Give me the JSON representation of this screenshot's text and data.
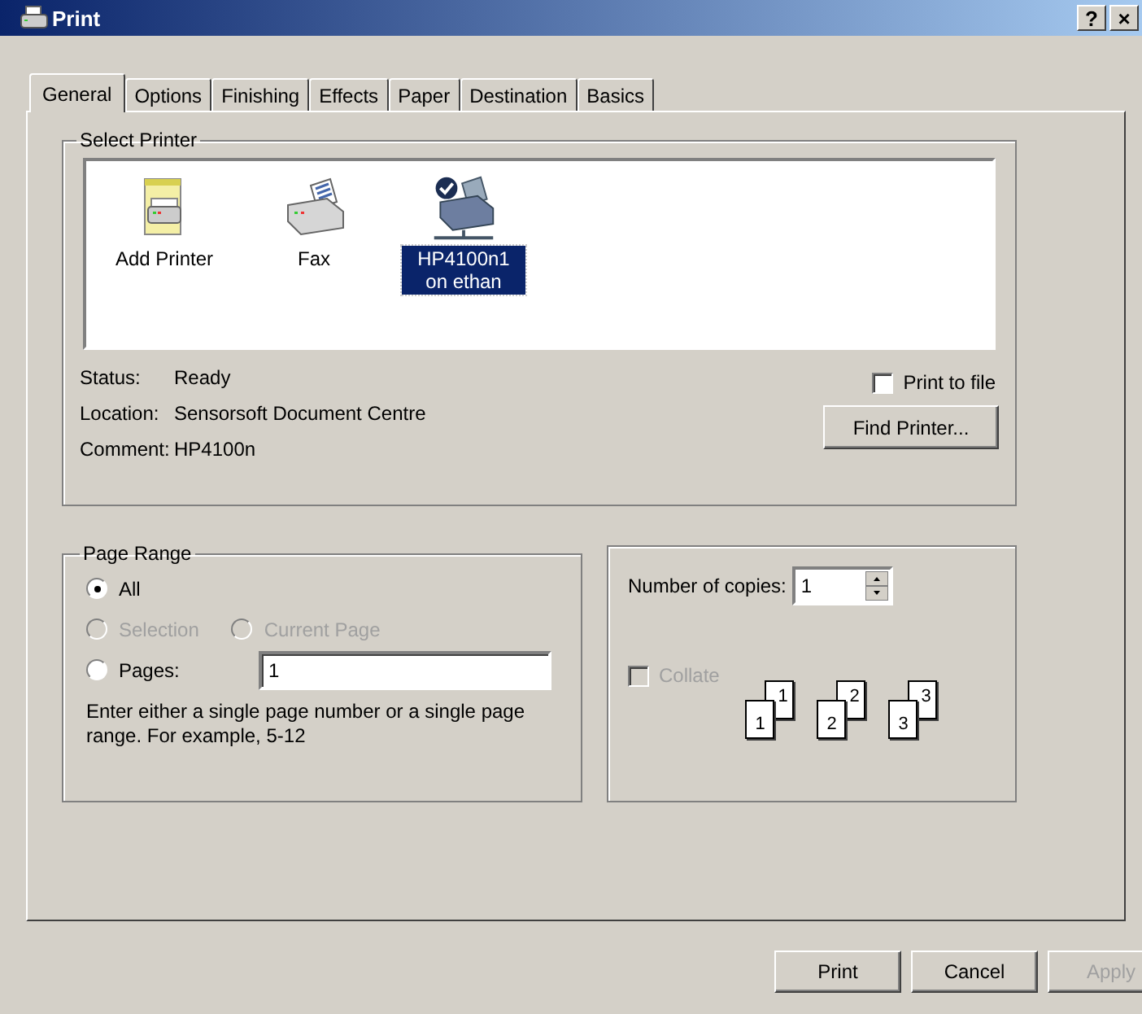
{
  "window": {
    "title": "Print",
    "help_button": "?",
    "close_button": "×"
  },
  "tabs": [
    {
      "label": "General",
      "selected": true
    },
    {
      "label": "Options",
      "selected": false
    },
    {
      "label": "Finishing",
      "selected": false
    },
    {
      "label": "Effects",
      "selected": false
    },
    {
      "label": "Paper",
      "selected": false
    },
    {
      "label": "Destination",
      "selected": false
    },
    {
      "label": "Basics",
      "selected": false
    }
  ],
  "select_printer": {
    "title": "Select Printer",
    "printers": [
      {
        "name": "Add Printer",
        "kind": "add",
        "selected": false
      },
      {
        "name": "Fax",
        "kind": "fax",
        "selected": false
      },
      {
        "name": "HP4100n1 on ethan",
        "kind": "network",
        "selected": true
      }
    ],
    "details": [
      {
        "label": "Status:",
        "value": "Ready"
      },
      {
        "label": "Location:",
        "value": "Sensorsoft Document Centre"
      },
      {
        "label": "Comment:",
        "value": "HP4100n"
      }
    ],
    "print_to_file": {
      "label": "Print to file",
      "checked": false
    },
    "find_button": "Find Printer..."
  },
  "page_range": {
    "title": "Page Range",
    "options": [
      {
        "label": "All",
        "selected": true,
        "disabled": false
      },
      {
        "label": "Selection",
        "selected": false,
        "disabled": true
      },
      {
        "label": "Current Page",
        "selected": false,
        "disabled": true
      },
      {
        "label": "Pages:",
        "selected": false,
        "disabled": false
      }
    ],
    "pages_value": "1",
    "hint": "Enter either a single page number or a single page range.  For example, 5-12"
  },
  "copies": {
    "label": "Number of copies:",
    "value": "1",
    "collate": {
      "label": "Collate",
      "checked": false,
      "disabled": true
    },
    "collate_stacks": [
      [
        "1",
        "1"
      ],
      [
        "2",
        "2"
      ],
      [
        "3",
        "3"
      ]
    ]
  },
  "buttons": [
    {
      "label": "Print",
      "disabled": false
    },
    {
      "label": "Cancel",
      "disabled": false
    },
    {
      "label": "Apply",
      "disabled": true
    }
  ]
}
